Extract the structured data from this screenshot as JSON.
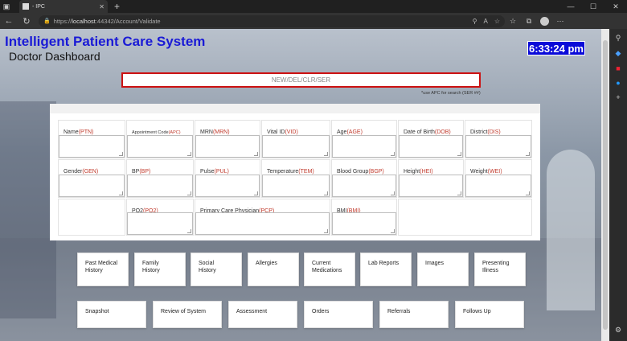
{
  "browser": {
    "tab_title": "- IPC",
    "url_prefix": "https://",
    "url_host": "localhost",
    "url_path": ":44342/Account/Validate",
    "new_tab": "+",
    "icons": {
      "back": "←",
      "refresh": "↻",
      "lock": "🔒",
      "read_aloud": "A",
      "favorite": "☆",
      "collections": "⧉",
      "profile": "●",
      "more": "⋯",
      "minimize": "—",
      "maximize": "☐",
      "close": "✕",
      "zoom": "⚲"
    }
  },
  "header": {
    "title": "Intelligent Patient Care System",
    "subtitle": "Doctor Dashboard",
    "clock": "6:33:24 pm"
  },
  "command": {
    "placeholder": "NEW/DEL/CLR/SER",
    "hint": "*use APC for search (SER ##)"
  },
  "fields": [
    {
      "label": "Name",
      "code": "(PTN)"
    },
    {
      "label": "Appointment Code",
      "code": "(APC)"
    },
    {
      "label": "MRN",
      "code": "(MRN)"
    },
    {
      "label": "Vital ID",
      "code": "(VID)"
    },
    {
      "label": "Age",
      "code": "(AGE)"
    },
    {
      "label": "Date of Birth",
      "code": "(DOB)"
    },
    {
      "label": "District",
      "code": "(DIS)"
    },
    {
      "label": "Gender",
      "code": "(GEN)"
    },
    {
      "label": "BP",
      "code": "(BP)"
    },
    {
      "label": "Pulse",
      "code": "(PUL)"
    },
    {
      "label": "Temperature",
      "code": "(TEM)"
    },
    {
      "label": "Blood Group",
      "code": "(BGP)"
    },
    {
      "label": "Height",
      "code": "(HEI)"
    },
    {
      "label": "Weight",
      "code": "(WEI)"
    },
    {
      "label": "PO2",
      "code": "(PO2)"
    },
    {
      "label": "Primary Care Physician",
      "code": "(PCP)"
    },
    {
      "label": "BMI",
      "code": "(BMI)"
    }
  ],
  "nav_row1": [
    "Past Medical\nHistory",
    "Family\nHistory",
    "Social\nHistory",
    "Allergies",
    "Current\nMedications",
    "Lab Reports",
    "Images",
    "Presenting\nIllness"
  ],
  "nav_row2": [
    "Snapshot",
    "Review of System",
    "Assessment",
    "Orders",
    "Referrals",
    "Follows Up"
  ]
}
